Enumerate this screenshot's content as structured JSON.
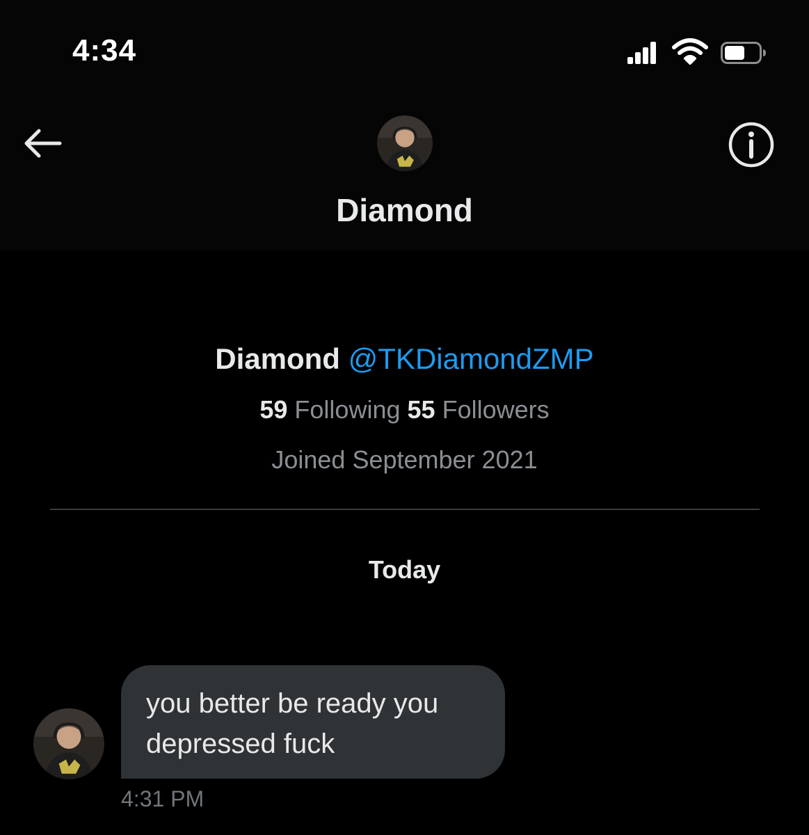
{
  "status_bar": {
    "time": "4:34",
    "icons": [
      "cellular-signal-icon",
      "wifi-icon",
      "battery-icon"
    ]
  },
  "header": {
    "name": "Diamond",
    "back_icon": "arrow-left-icon",
    "info_icon": "info-circle-icon"
  },
  "profile": {
    "display_name": "Diamond",
    "handle": "@TKDiamondZMP",
    "following_count": "59",
    "following_label": "Following",
    "followers_count": "55",
    "followers_label": "Followers",
    "joined": "Joined September 2021"
  },
  "conversation": {
    "day_label": "Today",
    "messages": [
      {
        "text": "you better be ready you\ndepressed fuck",
        "time": "4:31 PM"
      }
    ]
  },
  "colors": {
    "background": "#000000",
    "handle_blue": "#1d9bf0",
    "bubble": "#2f3336",
    "muted_text": "#8b8f94"
  }
}
